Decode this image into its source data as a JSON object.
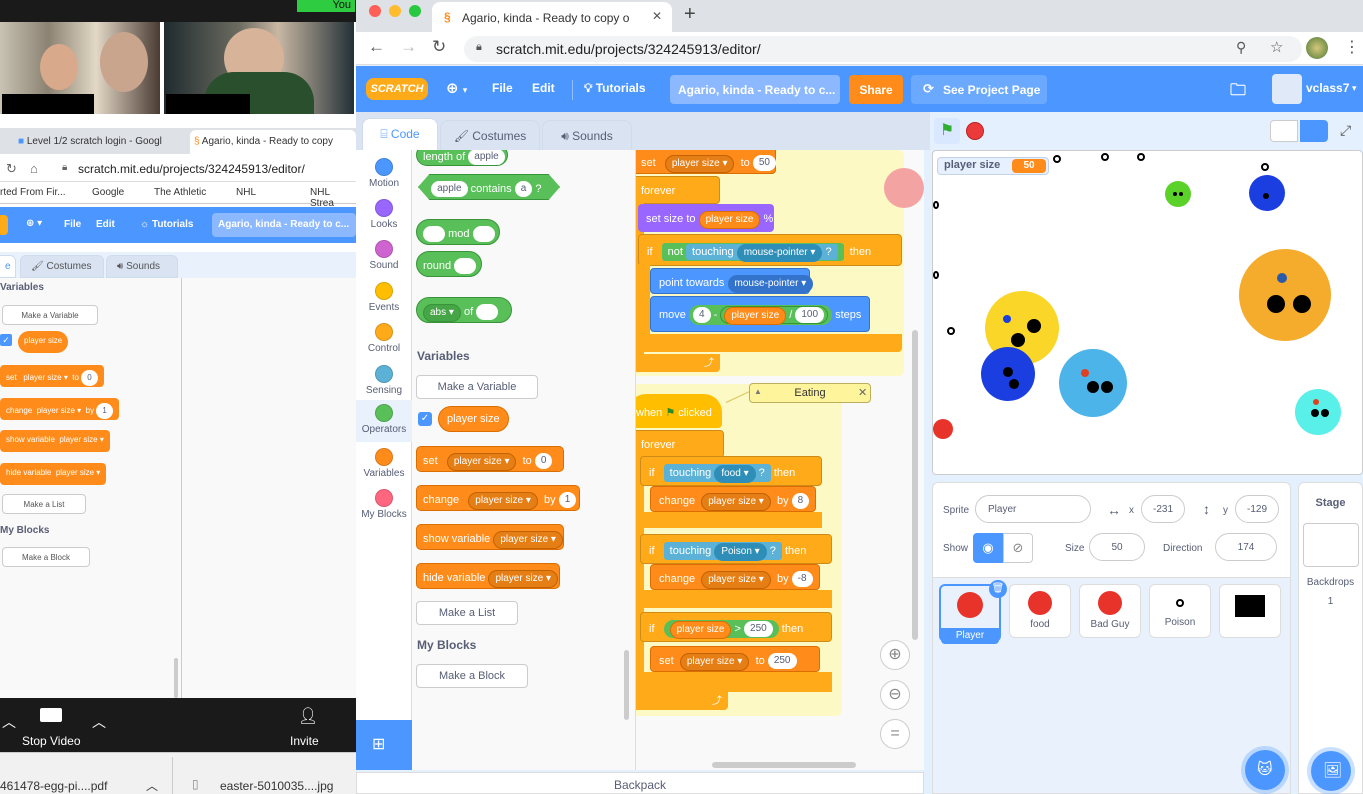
{
  "zoom": {
    "you_tag": "You",
    "stop_video": "Stop Video",
    "invite": "Invite"
  },
  "inner": {
    "tab1": "Level 1/2 scratch login - Googl",
    "tab2": "Agario, kinda - Ready to copy",
    "url": "scratch.mit.edu/projects/324245913/editor/",
    "bookmarks": [
      "rted From Fir...",
      "Google",
      "The Athletic",
      "NHL",
      "NHL Strea"
    ],
    "menu": {
      "file": "File",
      "edit": "Edit",
      "tutorials": "Tutorials",
      "title": "Agario, kinda - Ready to c..."
    },
    "tabs": {
      "code": "e",
      "costumes": "Costumes",
      "sounds": "Sounds"
    },
    "variables_heading": "Variables",
    "make_variable": "Make a Variable",
    "player_size": "player size",
    "set": "set",
    "to": "to",
    "zero": "0",
    "change": "change",
    "by": "by",
    "one": "1",
    "show_variable": "show variable",
    "hide_variable": "hide variable",
    "make_list": "Make a List",
    "my_blocks": "My Blocks",
    "make_block": "Make a Block"
  },
  "downloads": {
    "file1": "461478-egg-pi....pdf",
    "file2": "easter-5010035....jpg"
  },
  "browser": {
    "tab_title": "Agario, kinda - Ready to copy o",
    "url": "scratch.mit.edu/projects/324245913/editor/"
  },
  "menu": {
    "logo": "SCRATCH",
    "file": "File",
    "edit": "Edit",
    "tutorials": "Tutorials",
    "project_title": "Agario, kinda - Ready to c...",
    "share": "Share",
    "see_project": "See Project Page",
    "username": "vclass7"
  },
  "editor_tabs": {
    "code": "Code",
    "costumes": "Costumes",
    "sounds": "Sounds"
  },
  "categories": [
    {
      "label": "Motion",
      "color": "#4c97ff"
    },
    {
      "label": "Looks",
      "color": "#9966ff"
    },
    {
      "label": "Sound",
      "color": "#cf63cf"
    },
    {
      "label": "Events",
      "color": "#ffbf00"
    },
    {
      "label": "Control",
      "color": "#ffab19"
    },
    {
      "label": "Sensing",
      "color": "#5cb1d6"
    },
    {
      "label": "Operators",
      "color": "#59c059"
    },
    {
      "label": "Variables",
      "color": "#ff8c1a"
    },
    {
      "label": "My Blocks",
      "color": "#ff6680"
    }
  ],
  "palette": {
    "length_of": "length of",
    "apple": "apple",
    "contains": "contains",
    "a": "a",
    "q": "?",
    "mod": "mod",
    "round": "round",
    "abs": "abs",
    "of": "of",
    "variables_heading": "Variables",
    "make_variable": "Make a Variable",
    "player_size": "player size",
    "set": "set",
    "to": "to",
    "zero": "0",
    "change": "change",
    "by": "by",
    "one": "1",
    "show_variable": "show variable",
    "hide_variable": "hide variable",
    "make_list": "Make a List",
    "my_blocks_heading": "My Blocks",
    "make_block": "Make a Block"
  },
  "script1": {
    "set": "set",
    "player_size": "player size",
    "to": "to",
    "fifty": "50",
    "forever": "forever",
    "set_size_to": "set size to",
    "pct": "%",
    "if": "if",
    "not": "not",
    "touching": "touching",
    "mouse_pointer": "mouse-pointer",
    "q": "?",
    "then": "then",
    "point_towards": "point towards",
    "move": "move",
    "four": "4",
    "minus": "-",
    "div": "/",
    "hundred": "100",
    "steps": "steps"
  },
  "script2": {
    "when": "when",
    "clicked": "clicked",
    "forever": "forever",
    "if": "if",
    "touching": "touching",
    "food": "food",
    "q": "?",
    "then": "then",
    "change": "change",
    "player_size": "player size",
    "by": "by",
    "eight": "8",
    "poison": "Poison",
    "neg_eight": "-8",
    "gt": ">",
    "two_fifty": "250",
    "set": "set",
    "to": "to"
  },
  "comment": "Eating",
  "backpack": "Backpack",
  "stage": {
    "monitor_label": "player size",
    "monitor_value": "50"
  },
  "sprite_info": {
    "sprite_label": "Sprite",
    "sprite_name": "Player",
    "x_label": "x",
    "x": "-231",
    "y_label": "y",
    "y": "-129",
    "show_label": "Show",
    "size_label": "Size",
    "size": "50",
    "direction_label": "Direction",
    "direction": "174"
  },
  "sprites": [
    {
      "name": "Player"
    },
    {
      "name": "food"
    },
    {
      "name": "Bad Guy"
    },
    {
      "name": "Poison"
    },
    {
      "name": ""
    }
  ],
  "stage_panel": {
    "title": "Stage",
    "backdrops_label": "Backdrops",
    "backdrops_count": "1"
  }
}
